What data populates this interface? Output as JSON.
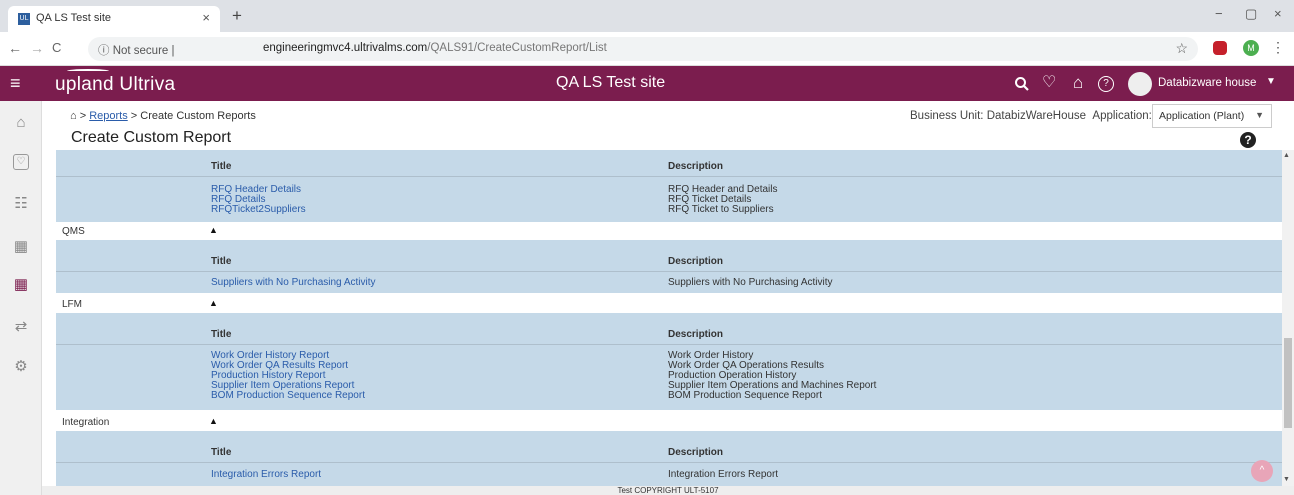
{
  "browser": {
    "tab_title": "QA LS Test site",
    "tab_close": "×",
    "new_tab": "+",
    "win_min": "−",
    "win_max": "▢",
    "win_close": "×",
    "back": "←",
    "forward": "→",
    "reload": "C",
    "security": "ⓘ Not secure  |",
    "url_host": "engineeringmvc4.ultrivalms.com",
    "url_path": "/QALS91/CreateCustomReport/List",
    "star": "☆",
    "profile_letter": "M",
    "menu": "⋮"
  },
  "header": {
    "logo": "upland Ultriva",
    "site_title": "QA LS Test site",
    "user": "Databizware house",
    "menu_icon": "≡",
    "search_icon": "🔍",
    "favorite_icon": "♡",
    "home_icon": "⌂",
    "help_icon": "?",
    "caret": "▼"
  },
  "sidebar": {
    "icons": [
      "⌂",
      "♡",
      "☷",
      "▦",
      "▦",
      "⇄",
      "⚙"
    ]
  },
  "breadcrumb": {
    "home": "⌂",
    "sep1": " > ",
    "reports": "Reports",
    "sep2": " > ",
    "current": "Create Custom Reports"
  },
  "page_title": "Create Custom Report",
  "business_unit": {
    "label": "Business Unit:",
    "value": "DatabizWareHouse",
    "app_label": "Application:",
    "app_value": "Application (Plant)",
    "caret": "▼"
  },
  "help_icon": "?",
  "columns": {
    "title": "Title",
    "description": "Description"
  },
  "sections": [
    {
      "name": "",
      "toggle": "",
      "rows": [
        {
          "title": "RFQ Header Details",
          "description": "RFQ Header and Details"
        },
        {
          "title": "RFQ Details",
          "description": "RFQ Ticket Details"
        },
        {
          "title": "RFQTicket2Suppliers",
          "description": "RFQ Ticket to Suppliers"
        }
      ]
    },
    {
      "name": "QMS",
      "toggle": "▲",
      "rows": [
        {
          "title": "Suppliers with No Purchasing Activity",
          "description": "Suppliers with No Purchasing Activity"
        }
      ]
    },
    {
      "name": "LFM",
      "toggle": "▲",
      "rows": [
        {
          "title": "Work Order History Report",
          "description": "Work Order History"
        },
        {
          "title": "Work Order QA Results Report",
          "description": "Work Order QA Operations Results"
        },
        {
          "title": "Production History Report",
          "description": "Production Operation History"
        },
        {
          "title": "Supplier Item Operations Report",
          "description": "Supplier Item Operations and Machines Report"
        },
        {
          "title": "BOM Production Sequence Report",
          "description": "BOM Production Sequence Report"
        }
      ]
    },
    {
      "name": "Integration",
      "toggle": "▲",
      "rows": [
        {
          "title": "Integration Errors Report",
          "description": "Integration Errors Report"
        }
      ]
    }
  ],
  "footer": "Test COPYRIGHT ULT-5107",
  "scroll_top_icon": "^"
}
